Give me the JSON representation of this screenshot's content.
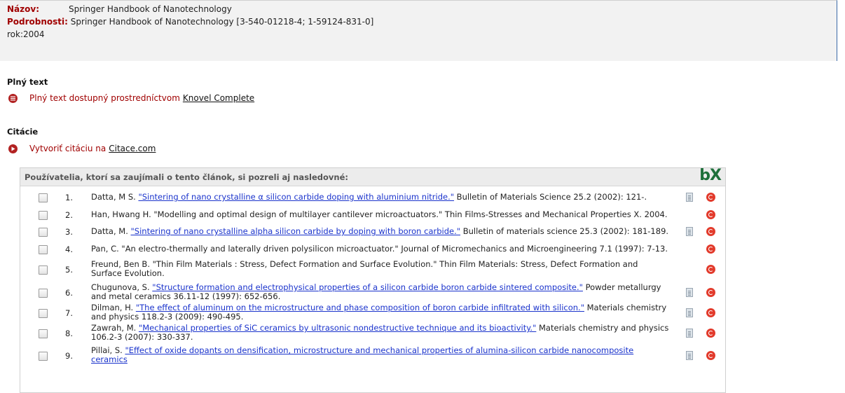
{
  "record": {
    "title_label": "Názov:",
    "title_value": "Springer Handbook of Nanotechnology",
    "details_label": "Podrobnosti:",
    "details_value": "Springer Handbook of Nanotechnology [3-540-01218-4; 1-59124-831-0]",
    "year": "rok:2004"
  },
  "fulltext": {
    "heading": "Plný text",
    "text": "Plný text dostupný prostredníctvom",
    "link": "Knovel Complete",
    "icon": "list-circle-icon"
  },
  "citations": {
    "heading": "Citácie",
    "text": "Vytvoriť citáciu na",
    "link": "Citace.com",
    "icon": "play-circle-icon"
  },
  "recommendations": {
    "heading": "Používatelia, ktorí sa zaujímali o tento článok, si pozreli aj nasledovné:",
    "logo": "bX",
    "items": [
      {
        "num": "1.",
        "pre": "Datta, M S. ",
        "link": "\"Sintering of nano crystalline α silicon carbide doping with aluminium nitride.\"",
        "post": " Bulletin of Materials Science 25.2 (2002): 121-.",
        "doc": true
      },
      {
        "num": "2.",
        "pre": "Han, Hwang H. \"Modelling and optimal design of multilayer cantilever microactuators.\" Thin Films-Stresses and Mechanical Properties X. 2004.",
        "link": "",
        "post": "",
        "doc": false
      },
      {
        "num": "3.",
        "pre": "Datta, M. ",
        "link": "\"Sintering of nano crystalline alpha silicon carbide by doping with boron carbide.\"",
        "post": " Bulletin of materials science 25.3 (2002): 181-189.",
        "doc": true
      },
      {
        "num": "4.",
        "pre": "Pan, C. \"An electro-thermally and laterally driven polysilicon microactuator.\" Journal of Micromechanics and Microengineering 7.1 (1997): 7-13.",
        "link": "",
        "post": "",
        "doc": false
      },
      {
        "num": "5.",
        "pre": "Freund, Ben B. \"Thin Film Materials : Stress, Defect Formation and Surface Evolution.\" Thin Film Materials: Stress, Defect Formation and Surface Evolution.",
        "link": "",
        "post": "",
        "doc": false
      },
      {
        "num": "6.",
        "pre": "Chugunova, S. ",
        "link": "\"Structure formation and electrophysical properties of a silicon carbide boron carbide sintered composite.\"",
        "post": " Powder metallurgy and metal ceramics 36.11-12 (1997): 652-656.",
        "doc": true
      },
      {
        "num": "7.",
        "pre": "Dilman, H. ",
        "link": "\"The effect of aluminum on the microstructure and phase composition of boron carbide infiltrated with silicon.\"",
        "post": " Materials chemistry and physics 118.2-3 (2009): 490-495.",
        "doc": true
      },
      {
        "num": "8.",
        "pre": "Zawrah, M. ",
        "link": "\"Mechanical properties of SiC ceramics by ultrasonic nondestructive technique and its bioactivity.\"",
        "post": " Materials chemistry and physics 106.2-3 (2007): 330-337.",
        "doc": true
      },
      {
        "num": "9.",
        "pre": "Pillai, S. ",
        "link": "\"Effect of oxide dopants on densification, microstructure and mechanical properties of alumina-silicon carbide nanocomposite ceramics",
        "post": "",
        "doc": true
      }
    ]
  }
}
